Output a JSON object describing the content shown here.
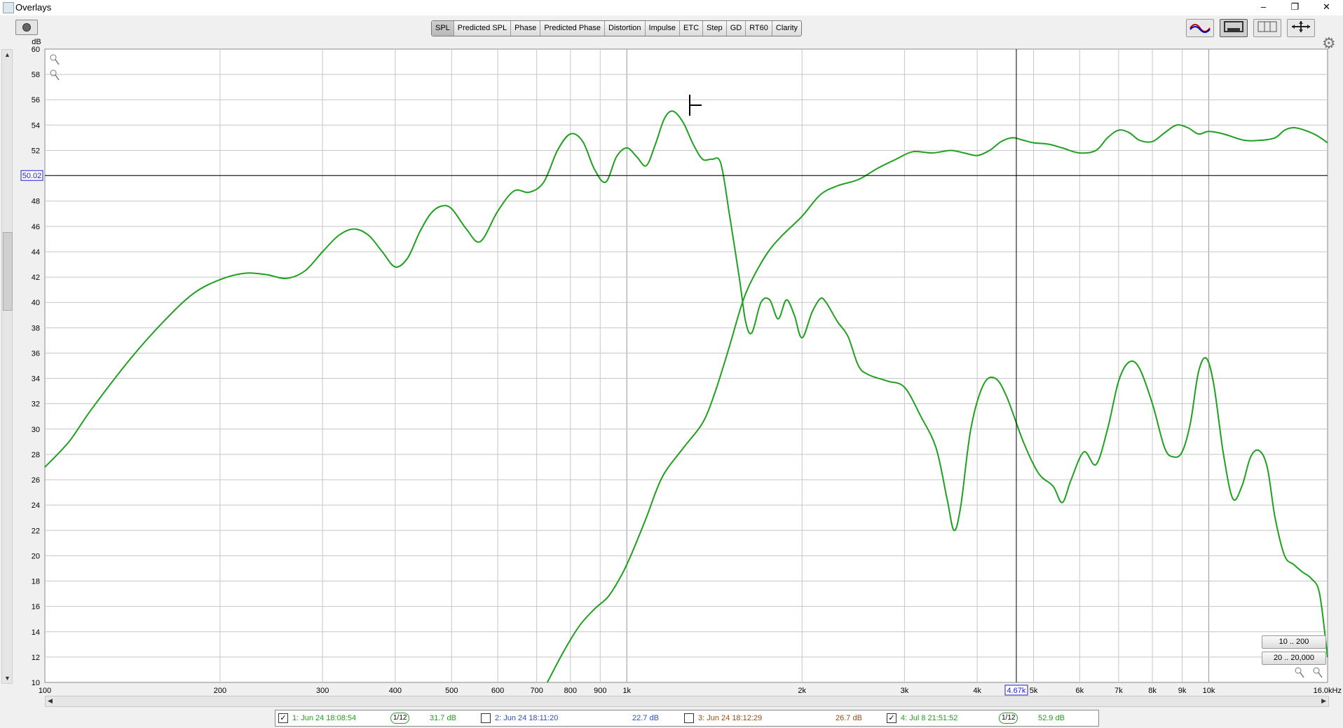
{
  "window": {
    "title": "Overlays",
    "minimize": "–",
    "restore": "❐",
    "close": "✕"
  },
  "tabs": [
    "SPL",
    "Predicted SPL",
    "Phase",
    "Predicted Phase",
    "Distortion",
    "Impulse",
    "ETC",
    "Step",
    "GD",
    "RT60",
    "Clarity"
  ],
  "active_tab": "SPL",
  "right_tools": [
    "freq-axis-icon",
    "controls-icon",
    "layout-icon",
    "expand-icon",
    "gear-icon"
  ],
  "range_buttons": [
    "10 .. 200",
    "20 .. 20,000"
  ],
  "colors": {
    "series_green": "#1fa01f",
    "grid": "#c6c6c6",
    "cursor": "#000000",
    "readout_border": "#1c1cd0"
  },
  "chart_data": {
    "type": "line",
    "title": "",
    "xlabel": "",
    "ylabel": "dB",
    "x_scale": "log",
    "xlim": [
      100,
      16000
    ],
    "ylim": [
      10,
      60
    ],
    "x_ticks": [
      100,
      200,
      300,
      400,
      500,
      600,
      700,
      800,
      900,
      1000,
      2000,
      3000,
      4000,
      5000,
      6000,
      7000,
      8000,
      9000,
      10000,
      16000
    ],
    "x_tick_labels": [
      "100",
      "200",
      "300",
      "400",
      "500",
      "600",
      "700",
      "800",
      "900",
      "1k",
      "2k",
      "3k",
      "4k",
      "5k",
      "6k",
      "7k",
      "8k",
      "9k",
      "10k",
      "16.0kHz"
    ],
    "y_ticks": [
      10,
      12,
      14,
      16,
      18,
      20,
      22,
      24,
      26,
      28,
      30,
      32,
      34,
      36,
      38,
      40,
      42,
      44,
      46,
      48,
      50,
      52,
      54,
      56,
      58,
      60
    ],
    "grid": true,
    "cursor": {
      "x_label": "4.67k",
      "y_label": "50.02",
      "x": 4670,
      "y": 50.02
    },
    "series": [
      {
        "name": "1: Jun 24 18:08:54",
        "points": [
          [
            100,
            27
          ],
          [
            110,
            29
          ],
          [
            120,
            31.5
          ],
          [
            140,
            35.5
          ],
          [
            160,
            38.5
          ],
          [
            180,
            40.7
          ],
          [
            200,
            41.8
          ],
          [
            220,
            42.3
          ],
          [
            240,
            42.2
          ],
          [
            260,
            41.9
          ],
          [
            280,
            42.5
          ],
          [
            300,
            44
          ],
          [
            320,
            45.3
          ],
          [
            340,
            45.8
          ],
          [
            360,
            45.3
          ],
          [
            380,
            44
          ],
          [
            400,
            42.8
          ],
          [
            420,
            43.5
          ],
          [
            440,
            45.5
          ],
          [
            460,
            47
          ],
          [
            480,
            47.6
          ],
          [
            500,
            47.4
          ],
          [
            530,
            45.8
          ],
          [
            560,
            44.8
          ],
          [
            600,
            47.2
          ],
          [
            640,
            48.8
          ],
          [
            680,
            48.7
          ],
          [
            720,
            49.5
          ],
          [
            760,
            52
          ],
          [
            800,
            53.3
          ],
          [
            840,
            52.7
          ],
          [
            880,
            50.5
          ],
          [
            920,
            49.5
          ],
          [
            960,
            51.5
          ],
          [
            1000,
            52.2
          ],
          [
            1040,
            51.5
          ],
          [
            1080,
            50.8
          ],
          [
            1120,
            52.5
          ],
          [
            1160,
            54.5
          ],
          [
            1200,
            55.1
          ],
          [
            1250,
            54.2
          ],
          [
            1300,
            52.5
          ],
          [
            1350,
            51.3
          ],
          [
            1400,
            51.3
          ],
          [
            1450,
            51
          ],
          [
            1500,
            47
          ],
          [
            1560,
            42
          ],
          [
            1600,
            38.5
          ],
          [
            1640,
            37.6
          ],
          [
            1700,
            40
          ],
          [
            1760,
            40.2
          ],
          [
            1820,
            38.7
          ],
          [
            1880,
            40.2
          ],
          [
            1940,
            39
          ],
          [
            2000,
            37.2
          ],
          [
            2080,
            39.2
          ],
          [
            2150,
            40.3
          ],
          [
            2200,
            40
          ],
          [
            2300,
            38.5
          ],
          [
            2400,
            37.3
          ],
          [
            2500,
            35
          ],
          [
            2600,
            34.3
          ],
          [
            2800,
            33.8
          ],
          [
            3000,
            33.3
          ],
          [
            3200,
            31
          ],
          [
            3400,
            28.5
          ],
          [
            3550,
            24.5
          ],
          [
            3650,
            22
          ],
          [
            3750,
            24
          ],
          [
            3900,
            30
          ],
          [
            4100,
            33.5
          ],
          [
            4300,
            34
          ],
          [
            4500,
            32.5
          ],
          [
            4800,
            29
          ],
          [
            5100,
            26.5
          ],
          [
            5400,
            25.5
          ],
          [
            5600,
            24.2
          ],
          [
            5800,
            26
          ],
          [
            6100,
            28.2
          ],
          [
            6400,
            27.2
          ],
          [
            6700,
            30
          ],
          [
            7000,
            33.8
          ],
          [
            7300,
            35.3
          ],
          [
            7600,
            34.8
          ],
          [
            8000,
            32
          ],
          [
            8400,
            28.5
          ],
          [
            8700,
            27.8
          ],
          [
            9000,
            28.2
          ],
          [
            9300,
            30.5
          ],
          [
            9600,
            34.5
          ],
          [
            9900,
            35.6
          ],
          [
            10200,
            33.5
          ],
          [
            10600,
            28
          ],
          [
            11000,
            24.5
          ],
          [
            11400,
            25.5
          ],
          [
            11800,
            27.8
          ],
          [
            12200,
            28.3
          ],
          [
            12600,
            27
          ],
          [
            13000,
            23
          ],
          [
            13500,
            20
          ],
          [
            14000,
            19.3
          ],
          [
            14500,
            18.7
          ],
          [
            15000,
            18.2
          ],
          [
            15500,
            17
          ],
          [
            16000,
            12
          ]
        ]
      },
      {
        "name": "4: Jul 8 21:51:52",
        "points": [
          [
            730,
            10
          ],
          [
            780,
            12.5
          ],
          [
            830,
            14.5
          ],
          [
            880,
            15.8
          ],
          [
            930,
            16.8
          ],
          [
            980,
            18.5
          ],
          [
            1020,
            20.2
          ],
          [
            1080,
            23
          ],
          [
            1150,
            26.2
          ],
          [
            1250,
            28.5
          ],
          [
            1350,
            30.5
          ],
          [
            1420,
            33
          ],
          [
            1500,
            36.5
          ],
          [
            1580,
            40
          ],
          [
            1650,
            42
          ],
          [
            1750,
            44
          ],
          [
            1850,
            45.3
          ],
          [
            2000,
            46.8
          ],
          [
            2150,
            48.5
          ],
          [
            2300,
            49.2
          ],
          [
            2500,
            49.7
          ],
          [
            2700,
            50.6
          ],
          [
            2900,
            51.3
          ],
          [
            3100,
            51.9
          ],
          [
            3350,
            51.8
          ],
          [
            3600,
            52
          ],
          [
            3800,
            51.8
          ],
          [
            4000,
            51.6
          ],
          [
            4200,
            52
          ],
          [
            4400,
            52.7
          ],
          [
            4600,
            53
          ],
          [
            4800,
            52.8
          ],
          [
            5000,
            52.6
          ],
          [
            5300,
            52.5
          ],
          [
            5600,
            52.2
          ],
          [
            6000,
            51.8
          ],
          [
            6400,
            52
          ],
          [
            6700,
            53
          ],
          [
            7000,
            53.6
          ],
          [
            7300,
            53.4
          ],
          [
            7600,
            52.8
          ],
          [
            8000,
            52.7
          ],
          [
            8400,
            53.4
          ],
          [
            8800,
            54
          ],
          [
            9200,
            53.8
          ],
          [
            9600,
            53.3
          ],
          [
            10000,
            53.5
          ],
          [
            10600,
            53.3
          ],
          [
            11500,
            52.8
          ],
          [
            12300,
            52.8
          ],
          [
            13000,
            53
          ],
          [
            13500,
            53.6
          ],
          [
            14000,
            53.8
          ],
          [
            14600,
            53.6
          ],
          [
            15300,
            53.2
          ],
          [
            16000,
            52.6
          ]
        ]
      }
    ],
    "legend": [
      {
        "name": "1: Jun 24 18:08:54",
        "checked": true,
        "smoothing": "1/12",
        "level": "31.7 dB",
        "color": "#1fa01f"
      },
      {
        "name": "2: Jun 24 18:11:20",
        "checked": false,
        "smoothing": "",
        "level": "22.7 dB",
        "color": "#2b4fc0"
      },
      {
        "name": "3: Jun 24 18:12:29",
        "checked": false,
        "smoothing": "",
        "level": "26.7 dB",
        "color": "#a04a10"
      },
      {
        "name": "4: Jul 8 21:51:52",
        "checked": true,
        "smoothing": "1/12",
        "level": "52.9 dB",
        "color": "#1fa01f"
      }
    ]
  }
}
